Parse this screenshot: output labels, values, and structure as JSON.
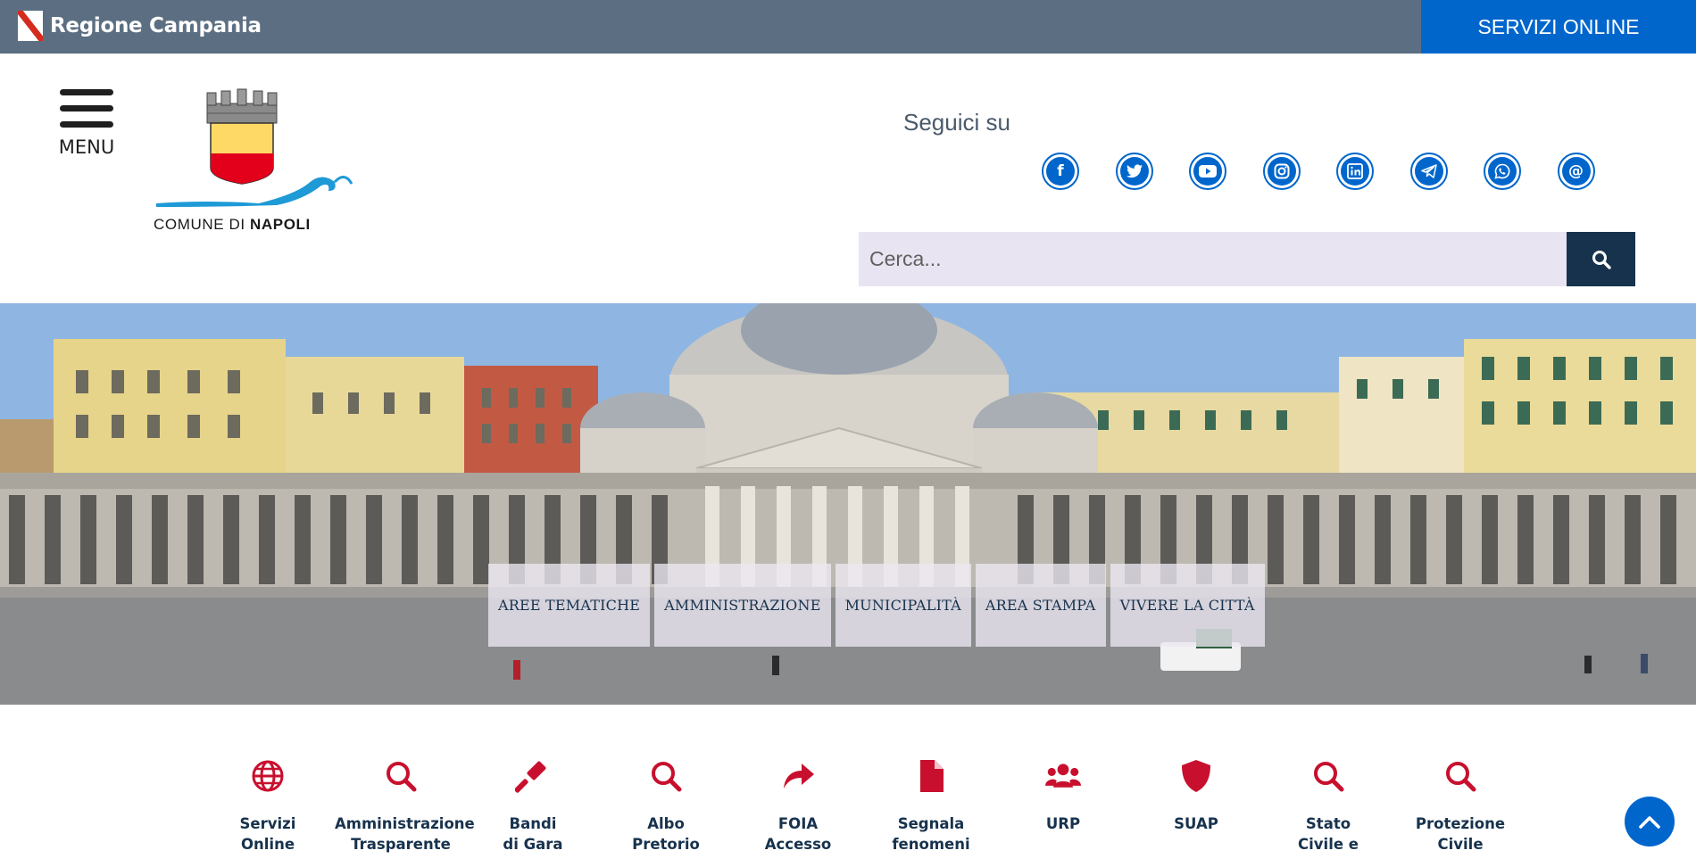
{
  "topbar": {
    "region_label": "Regione Campania",
    "services_label": "SERVIZI ONLINE"
  },
  "header": {
    "menu_label": "MENU",
    "logo_text_prefix": "COMUNE DI ",
    "logo_text_bold": "NAPOLI",
    "follow_label": "Seguici su",
    "socials": [
      "facebook-icon",
      "twitter-icon",
      "youtube-icon",
      "instagram-icon",
      "linkedin-icon",
      "telegram-icon",
      "whatsapp-icon",
      "threads-icon"
    ],
    "search_placeholder": "Cerca...",
    "search_value": ""
  },
  "nav": {
    "items": [
      "AREE TEMATICHE",
      "AMMINISTRAZIONE",
      "MUNICIPALITÀ",
      "AREA STAMPA",
      "VIVERE LA CITTÀ"
    ]
  },
  "quick_links": [
    {
      "label": "Servizi\nOnline",
      "icon": "globe-icon"
    },
    {
      "label": "Amministrazione\nTrasparente",
      "icon": "search-icon"
    },
    {
      "label": "Bandi\ndi Gara",
      "icon": "gavel-icon"
    },
    {
      "label": "Albo\nPretorio",
      "icon": "search-icon"
    },
    {
      "label": "FOIA\nAccesso",
      "icon": "share-arrow-icon"
    },
    {
      "label": "Segnala\nfenomeni",
      "icon": "file-icon"
    },
    {
      "label": "URP",
      "icon": "users-icon"
    },
    {
      "label": "SUAP",
      "icon": "shield-icon"
    },
    {
      "label": "Stato\nCivile e",
      "icon": "search-icon"
    },
    {
      "label": "Protezione\nCivile",
      "icon": "search-icon"
    }
  ],
  "colors": {
    "topbar": "#5c6f82",
    "primary_blue": "#0066cc",
    "dark_navy": "#17324d",
    "accent_red": "#c8102e",
    "search_bg": "#e8e4f1"
  }
}
